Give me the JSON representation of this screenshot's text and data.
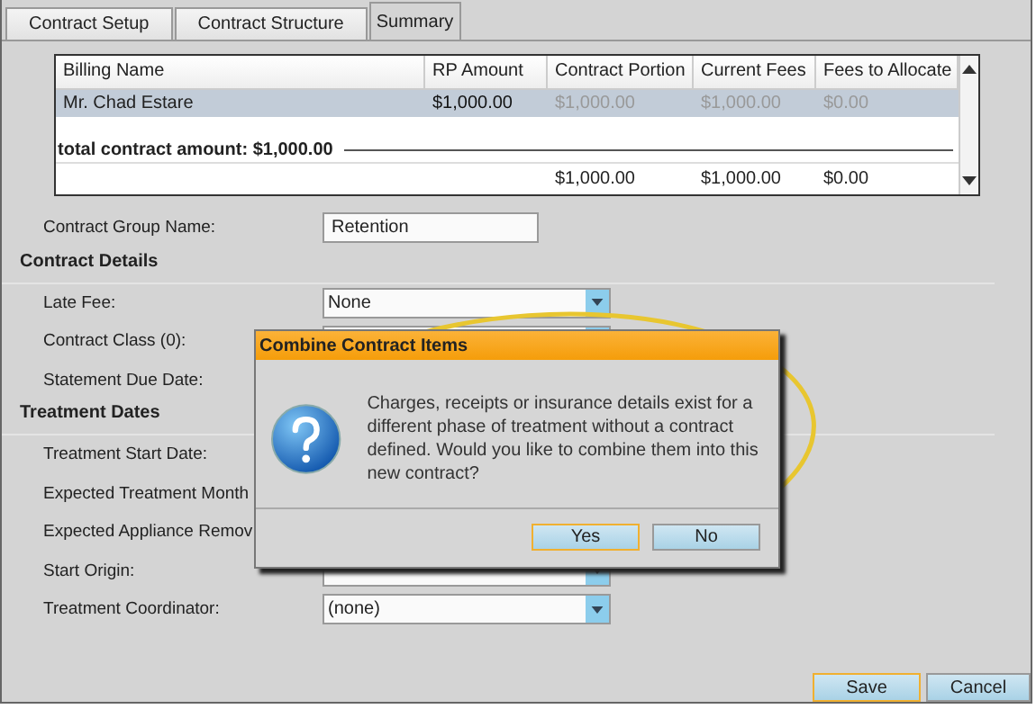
{
  "tabs": [
    {
      "label": "Contract Setup",
      "selected": false
    },
    {
      "label": "Contract Structure",
      "selected": false
    },
    {
      "label": "Summary",
      "selected": true
    }
  ],
  "table": {
    "columns": [
      "Billing Name",
      "RP Amount",
      "Contract Portion",
      "Current Fees",
      "Fees to Allocate"
    ],
    "rows": [
      {
        "selected": true,
        "cells": [
          {
            "text": "Mr. Chad Estare",
            "disabled": false
          },
          {
            "text": "$1,000.00",
            "disabled": false
          },
          {
            "text": "$1,000.00",
            "disabled": true
          },
          {
            "text": "$1,000.00",
            "disabled": true
          },
          {
            "text": "$0.00",
            "disabled": true
          }
        ]
      }
    ],
    "total_label": "total contract amount: $1,000.00",
    "totals": [
      "$1,000.00",
      "$1,000.00",
      "$0.00"
    ]
  },
  "form": [
    {
      "rows": [
        {
          "label": "Contract Group Name:",
          "kind": "text",
          "value": "Retention"
        }
      ]
    },
    {
      "heading": "Contract Details",
      "rows": [
        {
          "label": "Late Fee:",
          "kind": "dropdown",
          "value": "None"
        },
        {
          "label": "Contract Class (0):",
          "kind": "dropdown"
        },
        {
          "label": "Statement Due Date:",
          "kind": "hidden"
        }
      ]
    },
    {
      "heading": "Treatment Dates",
      "rows": [
        {
          "label": "Treatment Start Date:",
          "kind": "hidden"
        },
        {
          "label": "Expected Treatment Month",
          "kind": "hidden"
        },
        {
          "label": "Expected Appliance Remov",
          "kind": "hidden"
        },
        {
          "label": "Start Origin:",
          "kind": "dropdown"
        },
        {
          "label": "Treatment Coordinator:",
          "kind": "dropdown",
          "value": "(none)"
        }
      ]
    }
  ],
  "dialog": {
    "title": "Combine Contract Items",
    "message": "Charges, receipts or insurance details exist for a different phase of treatment without a contract defined.  Would you like to combine them into this new contract?",
    "buttons": [
      {
        "label": "Yes",
        "focused": true
      },
      {
        "label": "No",
        "focused": false
      }
    ]
  },
  "footer_buttons": [
    {
      "label": "Save",
      "focused": true
    },
    {
      "label": "Cancel",
      "focused": false
    }
  ]
}
